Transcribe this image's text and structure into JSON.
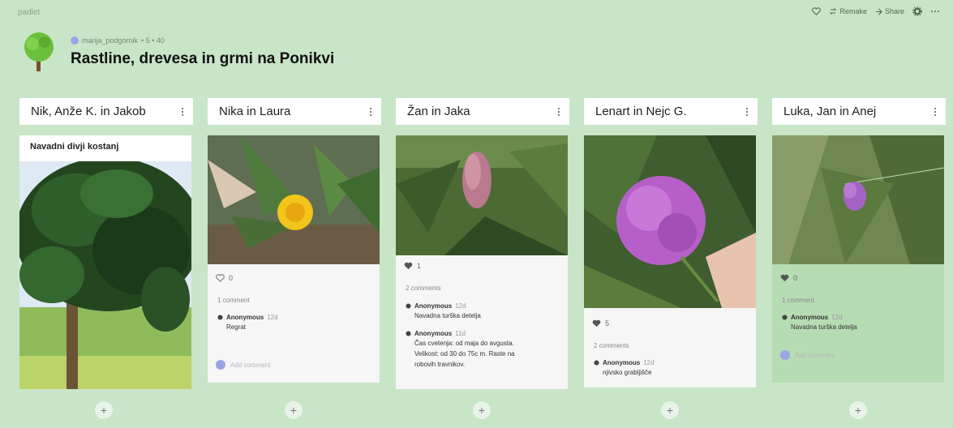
{
  "app": {
    "brand": "padlet"
  },
  "topnav": {
    "remake_label": "Remake",
    "share_label": "Share"
  },
  "header": {
    "author": "marija_podgornik",
    "meta_suffix": "• 5 • 40",
    "title": "Rastline, drevesa in grmi na Ponikvi"
  },
  "columns": [
    {
      "title": "Nik, Anže K. in Jakob"
    },
    {
      "title": "Nika in Laura"
    },
    {
      "title": "Žan in Jaka"
    },
    {
      "title": "Lenart in Nejc G."
    },
    {
      "title": "Luka, Jan in Anej"
    }
  ],
  "cards": [
    {
      "title": "Navadni divji kostanj"
    },
    {
      "likes": "0",
      "comments_count": "1 comment",
      "comments": [
        {
          "author": "Anonymous",
          "time": "12d",
          "text": "Regrat"
        }
      ],
      "add_placeholder": "Add comment"
    },
    {
      "likes": "1",
      "comments_count": "2 comments",
      "comments": [
        {
          "author": "Anonymous",
          "time": "12d",
          "text": "Navadna turška detelja"
        },
        {
          "author": "Anonymous",
          "time": "11d",
          "text_lines": [
            "Čas cvetenja: od maja do avgusta.",
            "Velikost: od 30 do 75c m. Raste na",
            "robovih travnikov."
          ]
        }
      ]
    },
    {
      "likes": "5",
      "comments_count": "2 comments",
      "comments": [
        {
          "author": "Anonymous",
          "time": "12d",
          "text": "njivsko grabljišče"
        }
      ]
    },
    {
      "likes": "0",
      "comments_count": "1 comment",
      "comments": [
        {
          "author": "Anonymous",
          "time": "12d",
          "text": "Navadna turška detelja"
        }
      ],
      "add_placeholder": "Add comment"
    }
  ],
  "colors": {
    "background": "#c8e5c8",
    "card": "#f6f6f6",
    "card_green": "#b6dcb4",
    "avatar": "#9aa5e6"
  },
  "icons": [
    "heart-icon",
    "remake-icon",
    "share-icon",
    "gear-icon",
    "more-icon",
    "comment-user-icon",
    "plus-icon"
  ]
}
